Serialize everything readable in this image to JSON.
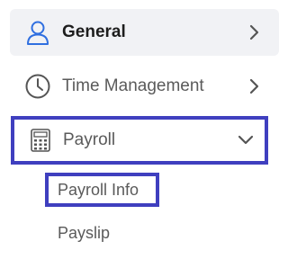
{
  "nav": {
    "items": [
      {
        "label": "General",
        "icon": "user-icon",
        "chevron": "chevron-right-icon"
      },
      {
        "label": "Time Management",
        "icon": "clock-icon",
        "chevron": "chevron-right-icon"
      },
      {
        "label": "Payroll",
        "icon": "calculator-icon",
        "chevron": "chevron-down-icon"
      }
    ],
    "payroll_subitems": [
      {
        "label": "Payroll Info"
      },
      {
        "label": "Payslip"
      }
    ]
  },
  "colors": {
    "accent_border": "#3f3fbf",
    "icon_blue": "#2f6fe0",
    "selected_bg": "#f1f2f5",
    "text_muted": "#5a5a5a"
  }
}
